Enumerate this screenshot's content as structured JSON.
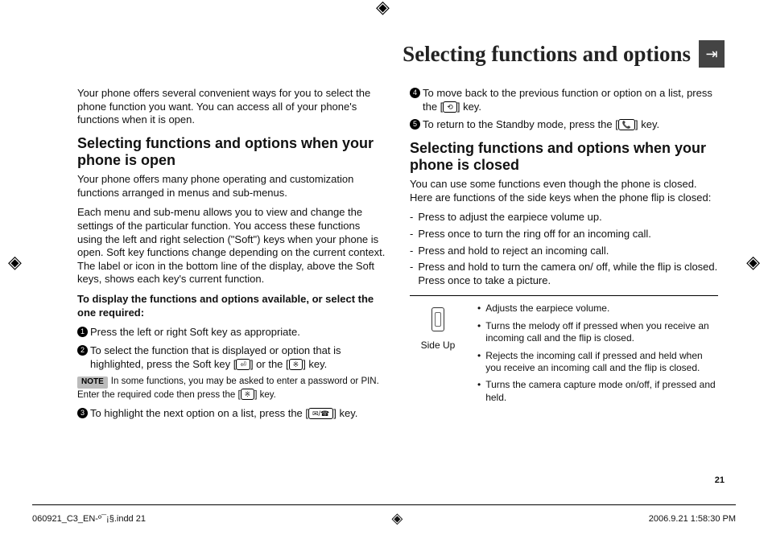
{
  "header": {
    "title": "Selecting functions and options"
  },
  "intro": "Your phone offers several convenient ways for you to select the phone function you want. You can access all of your phone's functions when it is open.",
  "open": {
    "heading": "Selecting functions and options when your phone is open",
    "p1": "Your phone offers many phone operating and customization functions arranged in menus and sub-menus.",
    "p2": "Each menu and sub-menu allows you to view and change the settings of the particular function. You access these functions using the left and right selection (\"Soft\") keys when your phone is open. Soft key functions change depending on the current context. The label or icon in the bottom line of the display, above the Soft keys, shows each key's current function.",
    "lead": "To display the functions and options available, or select the one required:",
    "steps": {
      "1": "Press the left or right Soft key as appropriate.",
      "2a": "To select the function that is displayed or option that is highlighted, press the Soft key [",
      "2b": "] or the [",
      "2c": "] key.",
      "3a": "To highlight the next option on a list, press the [",
      "3b": "] key.",
      "4a": "To move back to the previous function or option on a list, press the [",
      "4b": "] key.",
      "5a": "To return to the Standby mode, press the [",
      "5b": "] key."
    },
    "note": {
      "label": "NOTE",
      "a": "In some functions, you may be asked to enter a password or PIN. Enter the required code then press the [",
      "b": "] key."
    }
  },
  "closed": {
    "heading": "Selecting functions and options when your phone is closed",
    "p1": "You can use some functions even though the phone is closed. Here are functions of the side keys when the phone flip is closed:",
    "dashes": {
      "1": "Press to adjust the earpiece volume up.",
      "2": "Press once to turn the ring off for an incoming call.",
      "3": "Press and hold to reject an incoming call.",
      "4": "Press and hold to turn the camera on/ off, while the flip is closed. Press once to take a picture."
    },
    "side": {
      "label": "Side Up",
      "b1": "Adjusts the earpiece volume.",
      "b2": "Turns the melody off if pressed when you receive an incoming call and the flip is closed.",
      "b3": "Rejects the incoming call if pressed and held when you receive an incoming call and the flip is closed.",
      "b4": "Turns the camera capture mode on/off, if pressed and held."
    }
  },
  "keys": {
    "ok": "⏎",
    "center": "※",
    "nav": "✉/☎",
    "back": "⟲",
    "end": "📞"
  },
  "pagenum": "21",
  "footer": {
    "left": "060921_C3_EN-º¯¡§.indd   21",
    "right": "2006.9.21   1:58:30 PM"
  },
  "glyphs": {
    "crop": "◈",
    "enter": "⇥"
  }
}
